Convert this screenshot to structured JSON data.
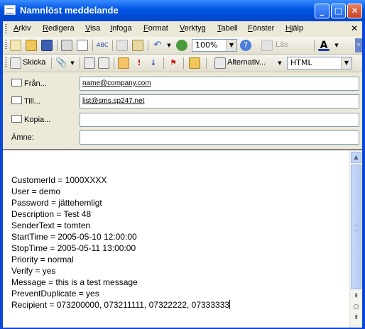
{
  "window": {
    "title": "Namnlöst meddelande",
    "minimize_glyph": "_",
    "maximize_glyph": "□",
    "close_glyph": "✕"
  },
  "menu": {
    "items": [
      "Arkiv",
      "Redigera",
      "Visa",
      "Infoga",
      "Format",
      "Verktyg",
      "Tabell",
      "Fönster",
      "Hjälp"
    ],
    "close_glyph": "✕"
  },
  "toolbar1": {
    "zoom": "100%",
    "read_label": "Läs"
  },
  "toolbar2": {
    "send_label": "Skicka",
    "options_label": "Alternativ...",
    "format_value": "HTML"
  },
  "headers": {
    "from_label": "Från...",
    "from_value": "name@company.com",
    "to_label": "Till...",
    "to_value": "list@sms.sp247.net",
    "cc_label": "Kopia...",
    "cc_value": "",
    "subject_label": "Ämne:",
    "subject_value": ""
  },
  "body": {
    "lines": [
      "CustomerId = 1000XXXX",
      "User = demo",
      "Password = jättehemligt",
      "Description = Test 48",
      "SenderText = tomten",
      "StartTime = 2005-05-10 12:00:00",
      "StopTime = 2005-05-11 13:00:00",
      "Priority = normal",
      "Verify = yes",
      "Message = this is a test message",
      "PreventDuplicate = yes",
      "Recipient = 073200000, 073211111, 07322222, 07333333"
    ]
  },
  "colors": {
    "titlebar": "#0054e3",
    "chrome": "#ece9d8"
  }
}
